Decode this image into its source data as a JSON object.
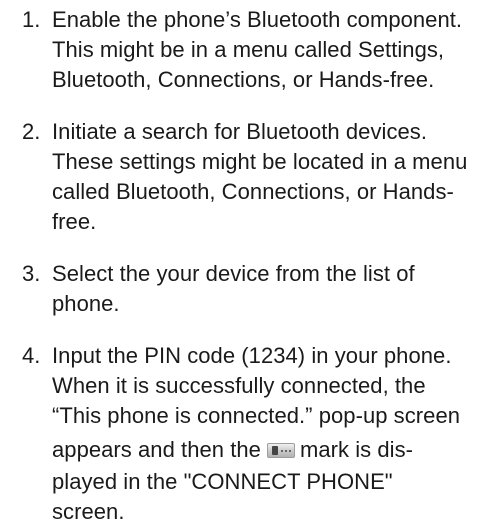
{
  "steps": [
    {
      "number": "1.",
      "lines": [
        "Enable the phone’s Bluetooth component.",
        "This might be in a menu called Settings,",
        "Bluetooth, Connections, or Hands-free."
      ]
    },
    {
      "number": "2.",
      "lines": [
        "Initiate a search for Bluetooth devices.",
        "These settings might be located in a menu",
        "called Bluetooth, Connections, or Hands-",
        "free."
      ]
    },
    {
      "number": "3.",
      "lines": [
        "Select the your device from the list of",
        "phone."
      ]
    },
    {
      "number": "4.",
      "lines": [
        "Input the PIN code (1234) in your phone.",
        "When it is successfully connected, the",
        "“This phone is connected.” pop-up screen"
      ],
      "line4_before": "appears and then the",
      "line4_after": "mark is dis-",
      "line5": "played in the \"CONNECT PHONE\"",
      "line6": "screen.",
      "icon": "bluetooth-phone-connected-icon"
    }
  ]
}
